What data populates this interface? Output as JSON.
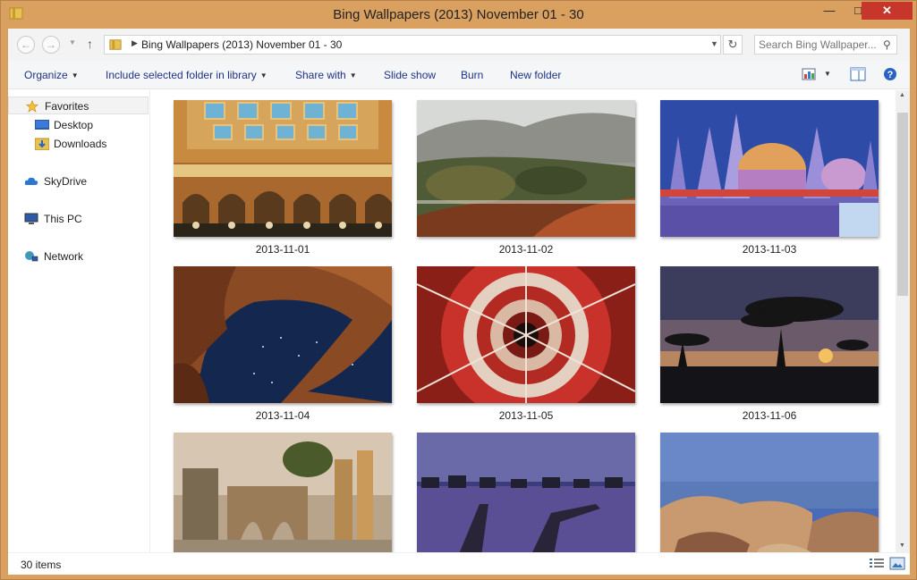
{
  "window": {
    "title": "Bing Wallpapers (2013) November 01 - 30",
    "minimize_glyph": "—",
    "maximize_glyph": "□",
    "close_glyph": "✕"
  },
  "address": {
    "path": "Bing Wallpapers (2013) November 01 - 30",
    "search_placeholder": "Search Bing Wallpaper..."
  },
  "toolbar": {
    "organize": "Organize",
    "include_library": "Include selected folder in library",
    "share_with": "Share with",
    "slide_show": "Slide show",
    "burn": "Burn",
    "new_folder": "New folder"
  },
  "sidebar": {
    "favorites": "Favorites",
    "desktop": "Desktop",
    "downloads": "Downloads",
    "skydrive": "SkyDrive",
    "this_pc": "This PC",
    "network": "Network"
  },
  "files": [
    {
      "name": "2013-11-01",
      "scene": "ornate-ceiling"
    },
    {
      "name": "2013-11-02",
      "scene": "misty-valley"
    },
    {
      "name": "2013-11-03",
      "scene": "temple-night"
    },
    {
      "name": "2013-11-04",
      "scene": "rock-arch-stars"
    },
    {
      "name": "2013-11-05",
      "scene": "spiral-staircase"
    },
    {
      "name": "2013-11-06",
      "scene": "acacia-sunset"
    },
    {
      "name": "",
      "scene": "ruins-sunset"
    },
    {
      "name": "",
      "scene": "pier-huts-dusk"
    },
    {
      "name": "",
      "scene": "rocky-coast"
    }
  ],
  "status": {
    "item_count": "30 items"
  },
  "colors": {
    "title_bar": "#d9a05f",
    "close_button": "#c7362b",
    "toolbar_text": "#1e3287"
  }
}
